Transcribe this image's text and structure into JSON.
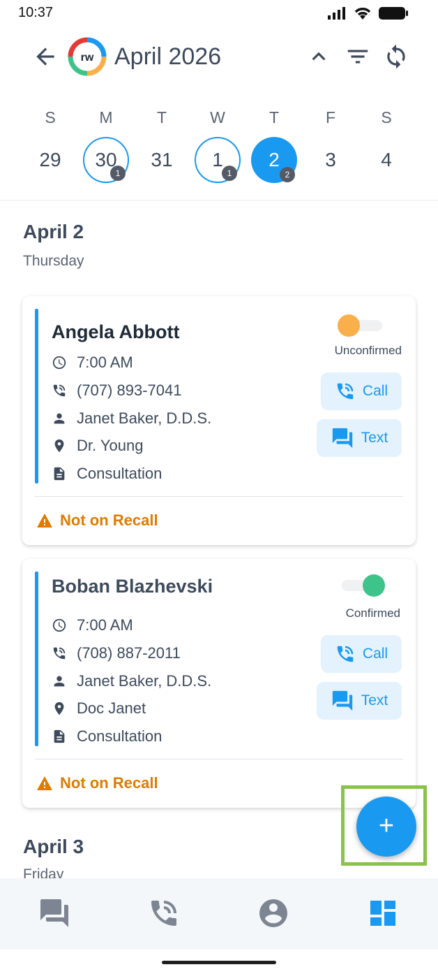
{
  "status_bar": {
    "time": "10:37"
  },
  "header": {
    "title": "April 2026",
    "logo_text": "rw"
  },
  "week": {
    "letters": [
      "S",
      "M",
      "T",
      "W",
      "T",
      "F",
      "S"
    ],
    "days": [
      {
        "num": "29",
        "badge": ""
      },
      {
        "num": "30",
        "badge": "1"
      },
      {
        "num": "31",
        "badge": ""
      },
      {
        "num": "1",
        "badge": "1"
      },
      {
        "num": "2",
        "badge": "2"
      },
      {
        "num": "3",
        "badge": ""
      },
      {
        "num": "4",
        "badge": ""
      }
    ]
  },
  "sections": [
    {
      "date": "April 2",
      "weekday": "Thursday"
    },
    {
      "date": "April 3",
      "weekday": "Friday"
    }
  ],
  "appointments": [
    {
      "name": "Angela Abbott",
      "time": "7:00 AM",
      "phone": "(707) 893-7041",
      "provider": "Janet Baker, D.D.S.",
      "location": "Dr. Young",
      "type": "Consultation",
      "status": "Unconfirmed",
      "recall": "Not on Recall",
      "call_label": "Call",
      "text_label": "Text"
    },
    {
      "name": "Boban Blazhevski",
      "time": "7:00 AM",
      "phone": "(708) 887-2011",
      "provider": "Janet Baker, D.D.S.",
      "location": "Doc Janet",
      "type": "Consultation",
      "status": "Confirmed",
      "recall": "Not on Recall",
      "call_label": "Call",
      "text_label": "Text"
    }
  ],
  "fab": {
    "label": "+"
  },
  "colors": {
    "accent": "#1a99f0",
    "unconfirmed": "#f9b04a",
    "confirmed": "#3ec48a",
    "warning": "#e07b00"
  }
}
